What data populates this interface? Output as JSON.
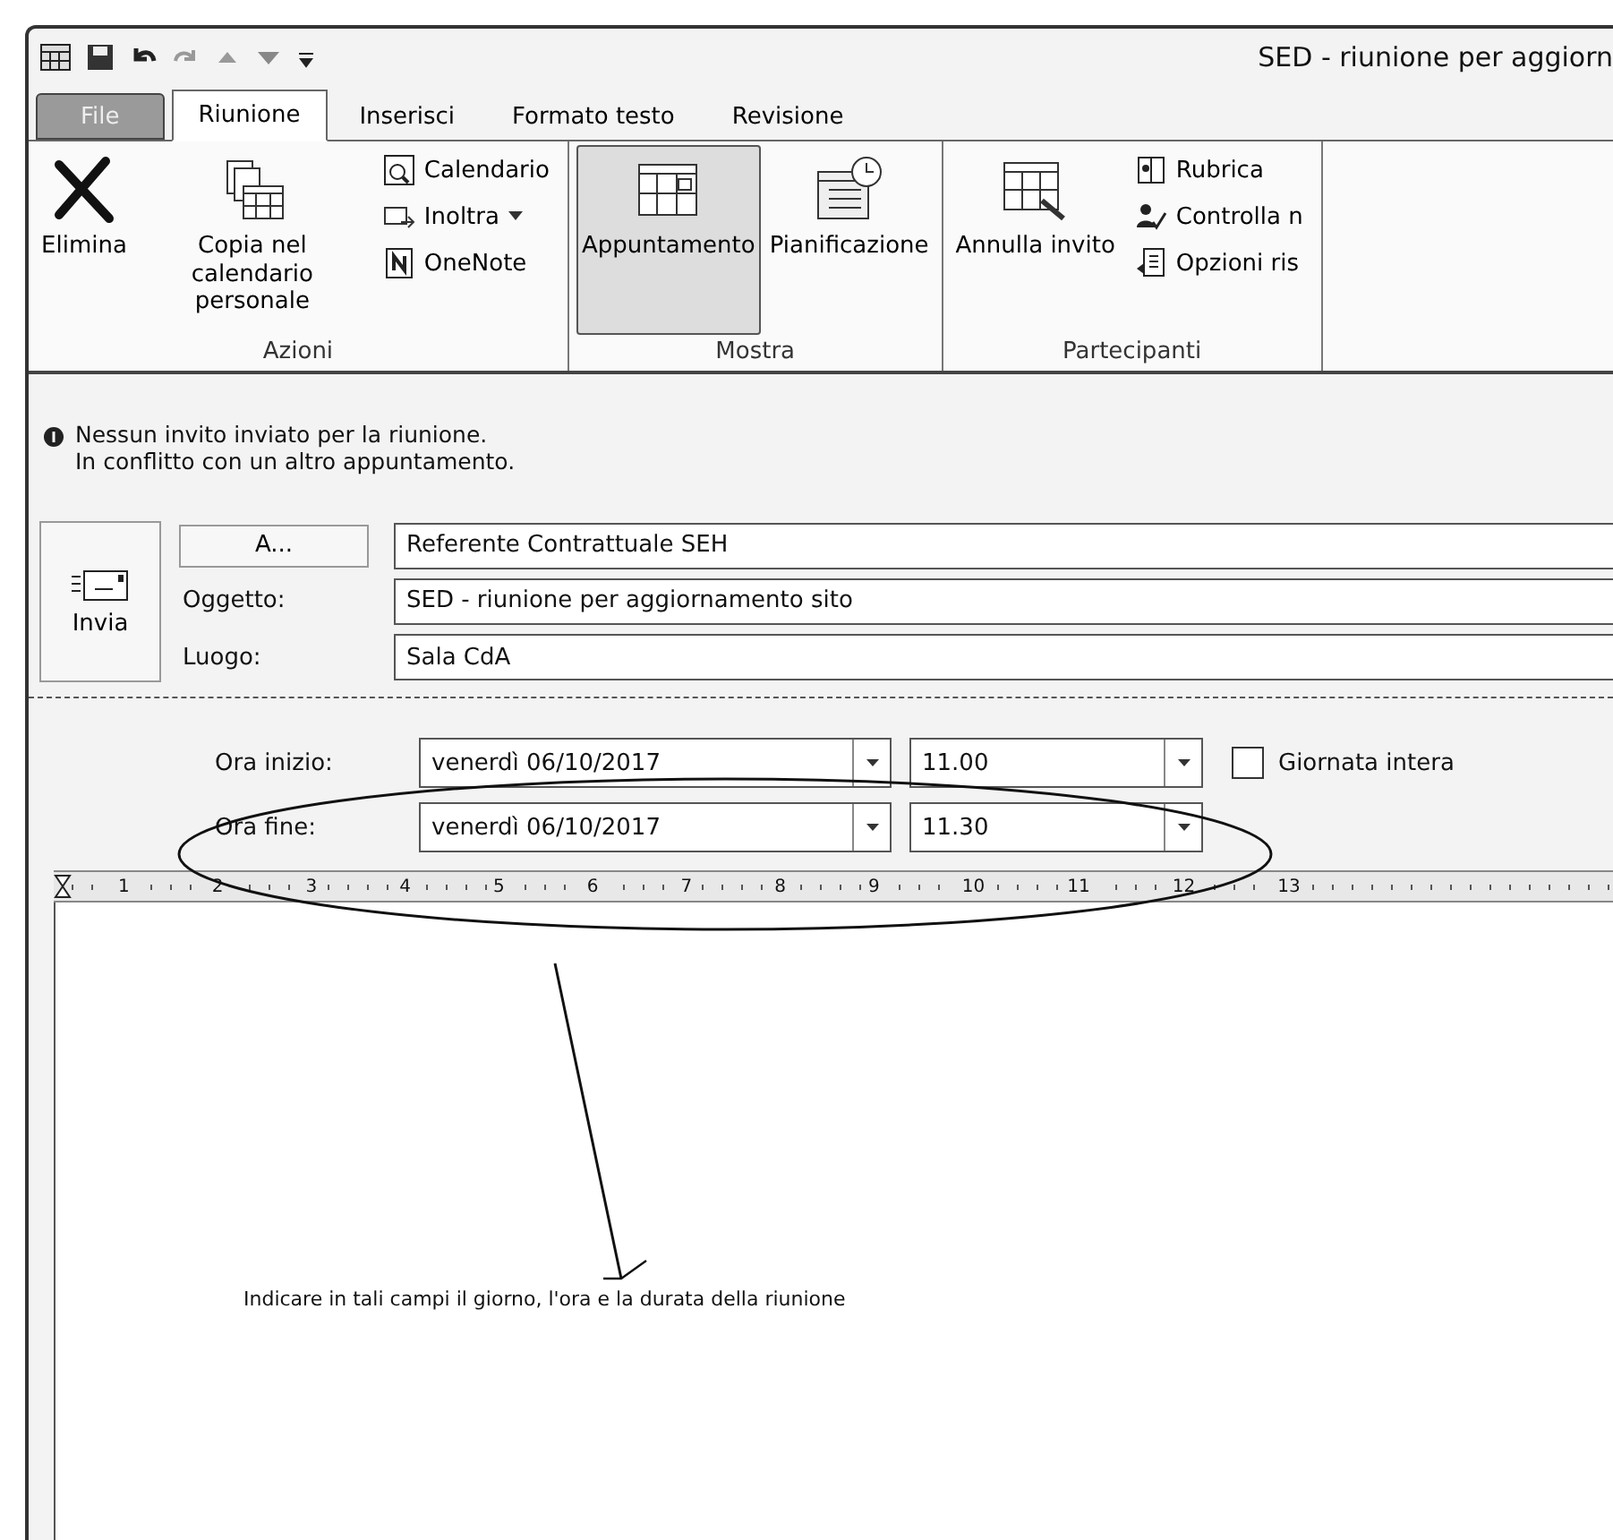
{
  "window": {
    "title": "SED - riunione per aggiorn"
  },
  "tabs": [
    {
      "label": "File",
      "kind": "file",
      "selected": false
    },
    {
      "label": "Riunione",
      "kind": "tab",
      "selected": true
    },
    {
      "label": "Inserisci",
      "kind": "tab",
      "selected": false
    },
    {
      "label": "Formato testo",
      "kind": "tab",
      "selected": false
    },
    {
      "label": "Revisione",
      "kind": "tab",
      "selected": false
    }
  ],
  "ribbon": {
    "groups": [
      {
        "label": "Azioni",
        "items": [
          {
            "kind": "large",
            "label": "Elimina",
            "selected": false
          },
          {
            "kind": "large",
            "label": "Copia nel calendario personale",
            "selected": false
          },
          {
            "kind": "small",
            "label": "Calendario"
          },
          {
            "kind": "small",
            "label": "Inoltra",
            "dropdown": true
          },
          {
            "kind": "small",
            "label": "OneNote"
          }
        ]
      },
      {
        "label": "Mostra",
        "items": [
          {
            "kind": "large",
            "label": "Appuntamento",
            "selected": true
          },
          {
            "kind": "large",
            "label": "Pianificazione",
            "selected": false
          }
        ]
      },
      {
        "label": "Partecipanti",
        "items": [
          {
            "kind": "large",
            "label": "Annulla invito",
            "selected": false
          },
          {
            "kind": "small",
            "label": "Rubrica"
          },
          {
            "kind": "small",
            "label": "Controlla n"
          },
          {
            "kind": "small",
            "label": "Opzioni ris"
          }
        ]
      }
    ]
  },
  "info": {
    "lines": [
      "Nessun invito inviato per la riunione.",
      "In conflitto con un altro appuntamento."
    ]
  },
  "form": {
    "send_button": "Invia",
    "to_button": "A...",
    "to_value": "Referente Contrattuale SEH",
    "subject_label": "Oggetto:",
    "subject_value": "SED - riunione per aggiornamento sito",
    "location_label": "Luogo:",
    "location_value": "Sala CdA"
  },
  "times": [
    {
      "label": "Ora inizio:",
      "date": "venerdì 06/10/2017",
      "time": "11.00"
    },
    {
      "label": "Ora fine:",
      "date": "venerdì 06/10/2017",
      "time": "11.30"
    }
  ],
  "all_day": {
    "label": "Giornata intera",
    "checked": false
  },
  "ruler": {
    "marks": [
      "1",
      "2",
      "3",
      "4",
      "5",
      "6",
      "7",
      "8",
      "9",
      "10",
      "11",
      "12",
      "13"
    ]
  },
  "annotation": {
    "text": "Indicare in tali campi il giorno, l'ora e la durata della riunione"
  }
}
